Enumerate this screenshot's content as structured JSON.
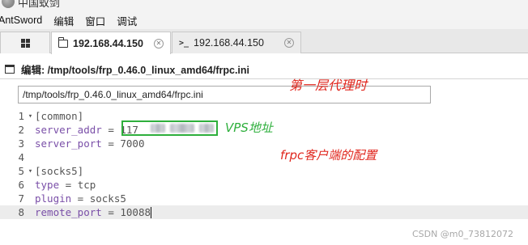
{
  "window": {
    "title": "中国蚁剑"
  },
  "menubar": {
    "items": [
      "AntSword",
      "编辑",
      "窗口",
      "调试"
    ]
  },
  "tabs": [
    {
      "label": "192.168.44.150",
      "icon": "folder-icon",
      "active": true
    },
    {
      "label": "192.168.44.150",
      "icon": "terminal-icon",
      "active": false
    }
  ],
  "panel": {
    "title": "编辑: /tmp/tools/frp_0.46.0_linux_amd64/frpc.ini",
    "path_value": "/tmp/tools/frp_0.46.0_linux_amd64/frpc.ini"
  },
  "editor": {
    "lines": [
      {
        "num": "1",
        "fold": "▾",
        "section": "[common]"
      },
      {
        "num": "2",
        "fold": "",
        "key": "server_addr",
        "op": " = ",
        "value": "117"
      },
      {
        "num": "3",
        "fold": "",
        "key": "server_port",
        "op": " = ",
        "value": "7000"
      },
      {
        "num": "4",
        "fold": "",
        "text": ""
      },
      {
        "num": "5",
        "fold": "▾",
        "section": "[socks5]"
      },
      {
        "num": "6",
        "fold": "",
        "key": "type",
        "op": " = ",
        "value": "tcp"
      },
      {
        "num": "7",
        "fold": "",
        "key": "plugin",
        "op": " = ",
        "value": "socks5"
      },
      {
        "num": "8",
        "fold": "",
        "key": "remote_port",
        "op": " = ",
        "value": "10088",
        "active": true
      }
    ]
  },
  "annotations": {
    "layer": "第一层代理时",
    "vps": "VPS地址",
    "frpc": "frpc客户端的配置"
  },
  "watermark": "CSDN @m0_73812072",
  "colors": {
    "red_annotation": "#e0261d",
    "green_annotation": "#2eaf3c",
    "key_purple": "#7a4fa8"
  }
}
